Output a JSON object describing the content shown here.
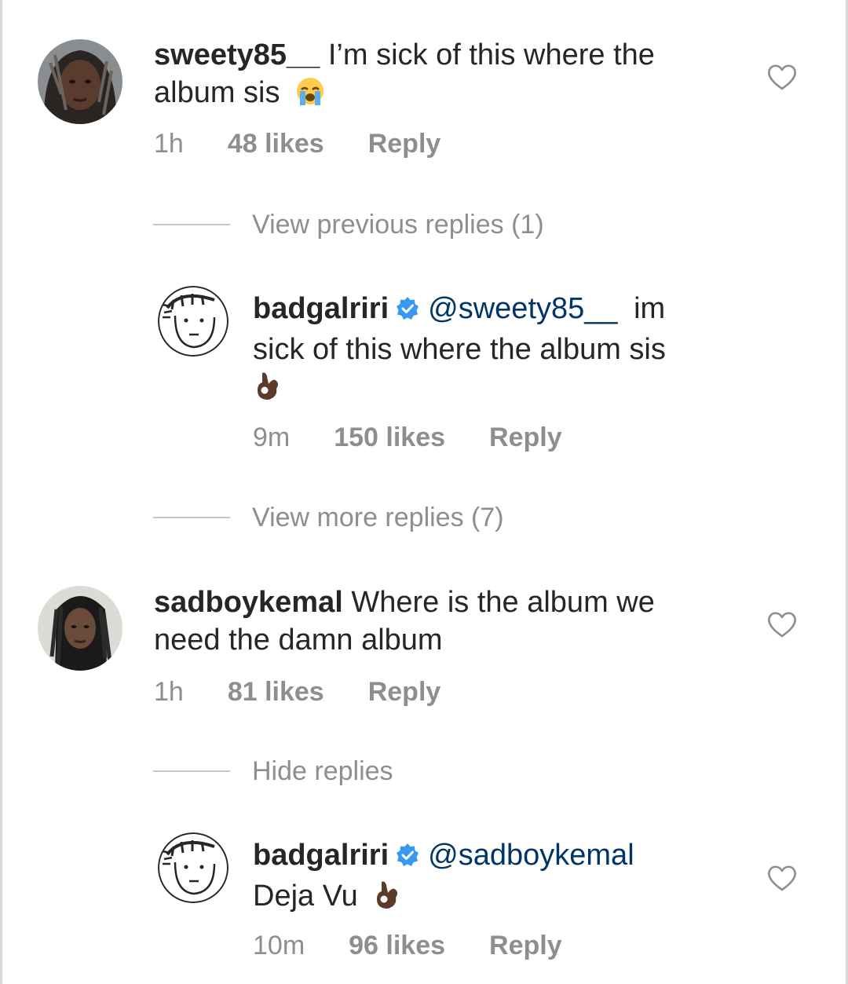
{
  "comments": [
    {
      "username": "sweety85__",
      "line1": "I’m sick of this where the",
      "line2": "album sis",
      "emoji": "loudly-crying-face",
      "time": "1h",
      "likes": "48 likes",
      "reply": "Reply"
    },
    {
      "username": "sadboykemal",
      "line1": "Where is the album we",
      "line2": "need the damn album",
      "time": "1h",
      "likes": "81 likes",
      "reply": "Reply"
    }
  ],
  "replies": [
    {
      "username": "badgalriri",
      "mention": "@sweety85__",
      "line1_rest": "im",
      "line2": "sick of this where the album sis",
      "emoji": "ok-hand",
      "time": "9m",
      "likes": "150 likes",
      "reply": "Reply"
    },
    {
      "username": "badgalriri",
      "mention": "@sadboykemal",
      "line2": "Deja Vu",
      "emoji": "ok-hand",
      "time": "10m",
      "likes": "96 likes",
      "reply": "Reply"
    }
  ],
  "threads": {
    "view_previous": "View previous replies (1)",
    "view_more": "View more replies (7)",
    "hide": "Hide replies"
  },
  "colors": {
    "text": "#262626",
    "secondary": "#8e8e8e",
    "mention": "#003569",
    "verified": "#3897f0"
  }
}
